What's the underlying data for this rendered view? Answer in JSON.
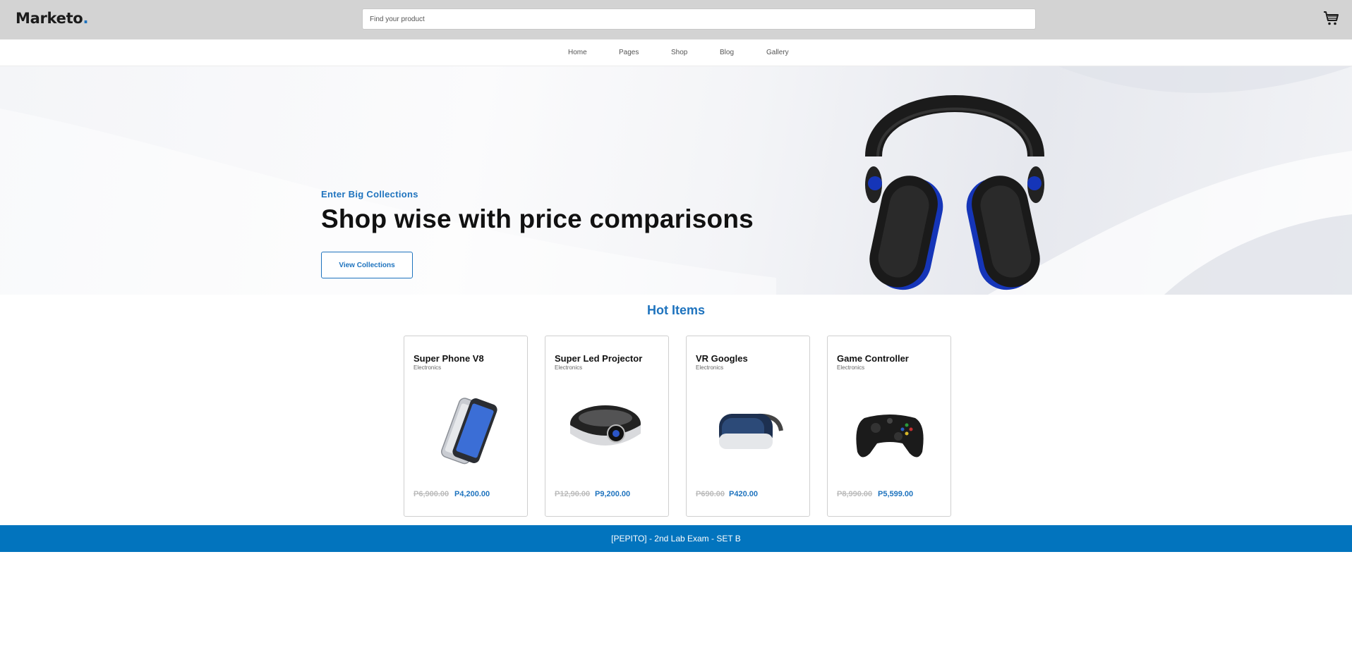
{
  "header": {
    "logo_text": "Marketo",
    "logo_dot": ".",
    "search_placeholder": "Find your product",
    "cart_icon": "cart-icon"
  },
  "nav": {
    "items": [
      "Home",
      "Pages",
      "Shop",
      "Blog",
      "Gallery"
    ]
  },
  "hero": {
    "kicker": "Enter Big Collections",
    "title": "Shop wise with price comparisons",
    "button_label": "View Collections",
    "image": "headphones-image"
  },
  "hot_items": {
    "title": "Hot Items",
    "products": [
      {
        "name": "Super Phone V8",
        "category": "Electronics",
        "old_price": "P6,900.00",
        "price": "P4,200.00",
        "image": "phone-image"
      },
      {
        "name": "Super Led Projector",
        "category": "Electronics",
        "old_price": "P12,90.00",
        "price": "P9,200.00",
        "image": "projector-image"
      },
      {
        "name": "VR Googles",
        "category": "Electronics",
        "old_price": "P690.00",
        "price": "P420.00",
        "image": "vr-headset-image"
      },
      {
        "name": "Game Controller",
        "category": "Electronics",
        "old_price": "P8,990.00",
        "price": "P5,599.00",
        "image": "game-controller-image"
      }
    ]
  },
  "footer": {
    "text": "[PEPITO] - 2nd Lab Exam - SET B"
  },
  "colors": {
    "accent": "#1e73be",
    "footer_bg": "#0274be",
    "header_bg": "#d3d3d3"
  }
}
